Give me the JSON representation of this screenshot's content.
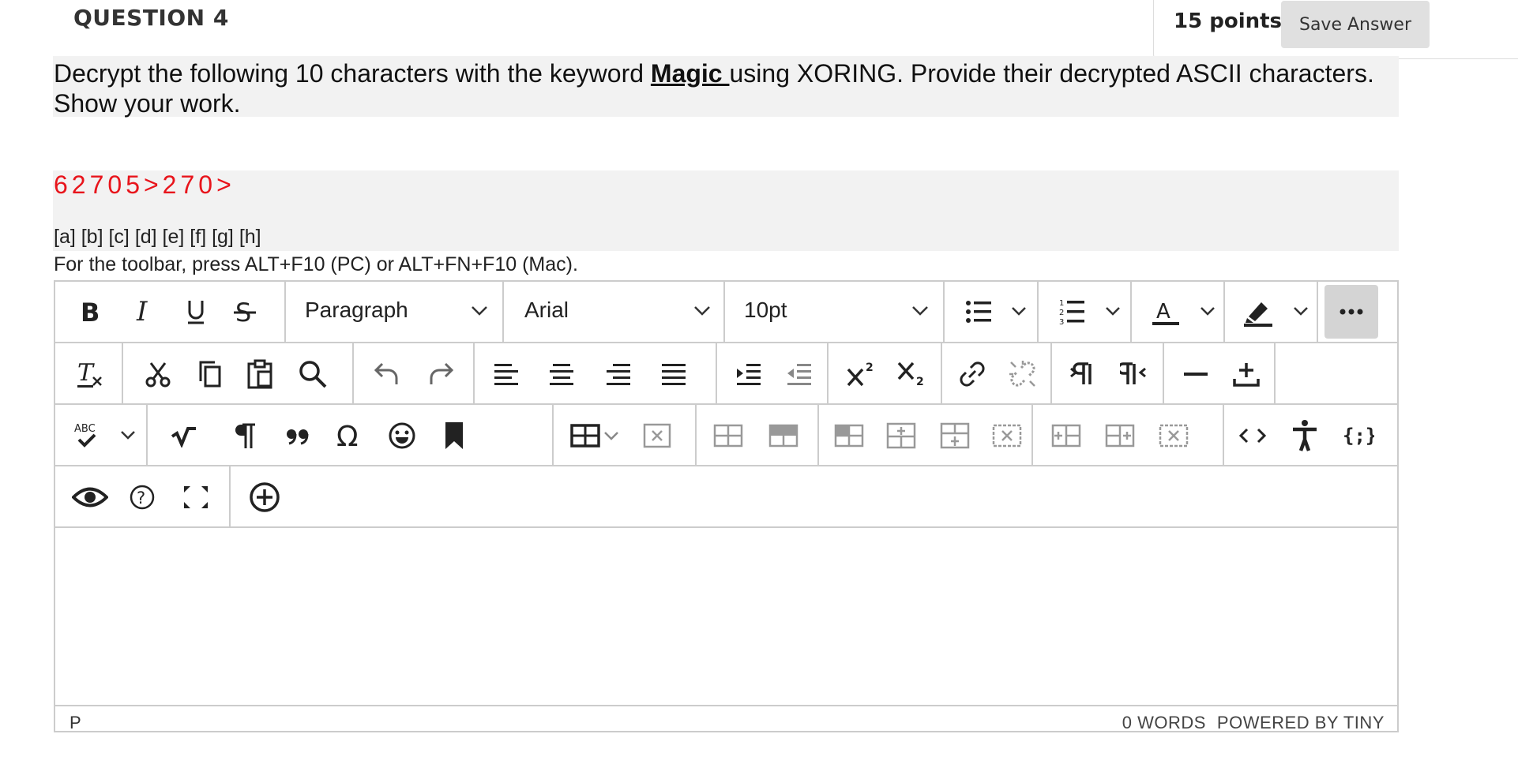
{
  "question": {
    "title": "QUESTION 4",
    "points": "15 points",
    "save_label": "Save Answer"
  },
  "prompt": {
    "before": "Decrypt the following 10 characters with the keyword ",
    "keyword": "Magic ",
    "after": "using XORING. Provide their decrypted ASCII characters. Show your work."
  },
  "ciphertext": "62705>270>",
  "blanks": "[a] [b] [c] [d] [e] [f] [g] [h]",
  "toolbar_hint": "For the toolbar, press ALT+F10 (PC) or ALT+FN+F10 (Mac).",
  "editor": {
    "block_format": "Paragraph",
    "font_family": "Arial",
    "font_size": "10pt",
    "spellcheck_label": "ABC",
    "status_path": "P",
    "word_count": "0 WORDS",
    "powered_by": "POWERED BY TINY"
  },
  "icons": [
    "bold-icon",
    "italic-icon",
    "underline-icon",
    "strikethrough-icon",
    "bullet-list-icon",
    "numbered-list-icon",
    "text-color-icon",
    "highlight-icon",
    "more-icon",
    "clear-format-icon",
    "cut-icon",
    "copy-icon",
    "paste-icon",
    "search-icon",
    "undo-icon",
    "redo-icon",
    "align-left-icon",
    "align-center-icon",
    "align-right-icon",
    "justify-icon",
    "indent-icon",
    "outdent-icon",
    "superscript-icon",
    "subscript-icon",
    "link-icon",
    "unlink-icon",
    "ltr-icon",
    "rtl-icon",
    "horizontal-rule-icon",
    "insert-icon",
    "spellcheck-icon",
    "math-icon",
    "paragraph-mark-icon",
    "blockquote-icon",
    "omega-icon",
    "emoji-icon",
    "bookmark-icon",
    "table-icon",
    "table-delete-icon",
    "table-row-icon",
    "table-col-icon",
    "table-cell-icon",
    "code-icon",
    "accessibility-icon",
    "source-code-icon",
    "preview-icon",
    "help-icon",
    "fullscreen-icon",
    "add-content-icon"
  ]
}
